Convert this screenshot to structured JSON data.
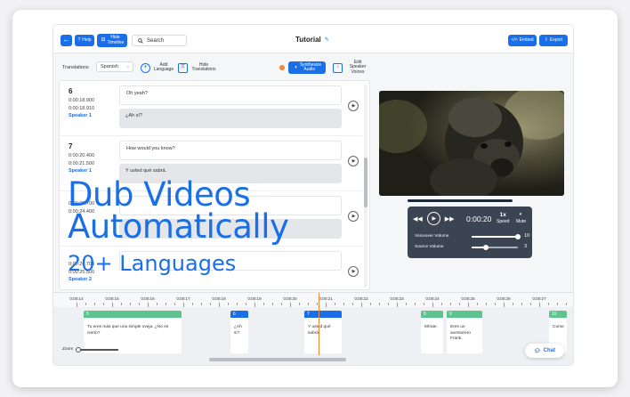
{
  "topbar": {
    "back_icon": "arrow-left-icon",
    "help_label": "Help",
    "hide_timeline_label": "Hide Timeline",
    "search_label": "Search",
    "title": "Tutorial",
    "embed_label": "Embed",
    "export_label": "Export"
  },
  "toolbar": {
    "translations_label": "Translations",
    "language_value": "Spanish",
    "add_language_label": "Add Language",
    "hide_translations_label": "Hide Translations",
    "synthesize_label": "Synthesize Audio",
    "edit_speaker_label": "Edit Speaker Voices"
  },
  "segments": [
    {
      "num": "6",
      "start": "0:00:18.910",
      "start_top": "0:00:18.900",
      "speaker": "Speaker 1",
      "en": "Oh yeah?",
      "es": "¿Ah sí?"
    },
    {
      "num": "7",
      "start_top": "0:00:20.400",
      "start": "0:00:21.500",
      "speaker": "Speaker 1",
      "en": "How would you know?",
      "es": "Y usted qué sabrá."
    },
    {
      "num": "",
      "start_top": "0:00:21.700",
      "start": "0:00:24.400",
      "speaker": "",
      "en": "",
      "es": ""
    },
    {
      "num": "",
      "start_top": "0:00:24.700",
      "start": "0:00:25.500",
      "speaker": "Speaker 2",
      "en": "",
      "es": ""
    }
  ],
  "player": {
    "time": "0:00:20",
    "speed_value": "1x",
    "speed_label": "Speed",
    "mute_label": "Mute",
    "voiceover_label": "Voiceover Volume",
    "voiceover_value": "10",
    "voiceover_level": 1.0,
    "source_label": "Source Volume",
    "source_value": "3",
    "source_level": 0.3,
    "progress": 1.0
  },
  "timeline": {
    "ticks": [
      "0:00:14",
      "0:00:15",
      "0:00:16",
      "0:00:17",
      "0:00:18",
      "0:00:19",
      "0:00:20",
      "0:00:21",
      "0:00:22",
      "0:00:23",
      "0:00:24",
      "0:00:25",
      "0:00:26",
      "0:00:27"
    ],
    "blocks": [
      {
        "num": "5",
        "text": "Tu eres más que una simple oveja. ¿No es cierto?",
        "color": "#5ec48e"
      },
      {
        "num": "6",
        "text": "¿Ah sí?",
        "color": "#1a6fe8"
      },
      {
        "num": "7",
        "text": "Y usted qué sabrá.",
        "color": "#1a6fe8"
      },
      {
        "num": "8",
        "text": "Mírate.",
        "color": "#5ec48e"
      },
      {
        "num": "9",
        "text": "Eres un aventurero Frank.",
        "color": "#5ec48e"
      },
      {
        "num": "10",
        "text": "Come",
        "color": "#5ec48e"
      }
    ],
    "zoom_label": "Zoom"
  },
  "chat_label": "Chat",
  "overlay": {
    "line1": "Dub Videos",
    "line2": "Automatically",
    "line3": "20+ Languages"
  },
  "colors": {
    "accent": "#1a6fe8",
    "controls_bg": "#3a4453",
    "orange": "#f08a3a",
    "green": "#5ec48e"
  }
}
